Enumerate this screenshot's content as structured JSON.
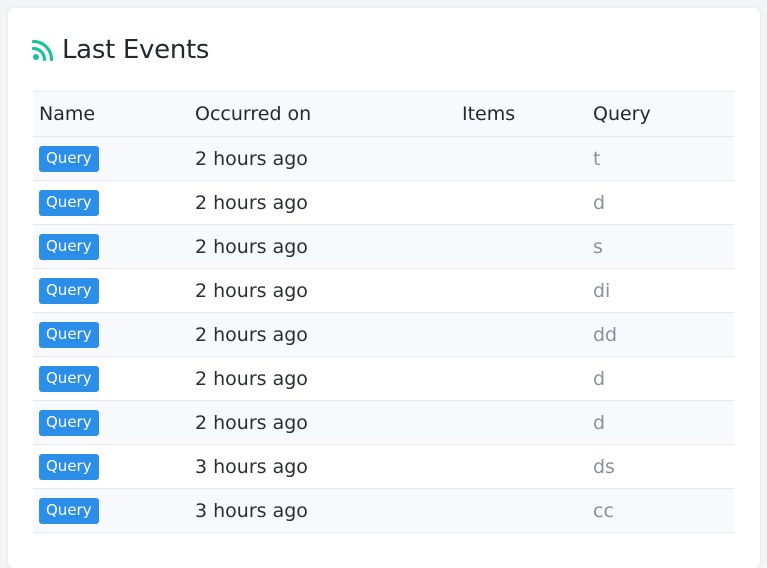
{
  "card": {
    "title": "Last Events",
    "icon": "rss-icon",
    "icon_color": "#19c3a0"
  },
  "table": {
    "headers": {
      "name": "Name",
      "occurred_on": "Occurred on",
      "items": "Items",
      "query": "Query"
    },
    "badge_color": "#2b8ee8",
    "rows": [
      {
        "name": "Query",
        "occurred_on": "2 hours ago",
        "items": "",
        "query": "t"
      },
      {
        "name": "Query",
        "occurred_on": "2 hours ago",
        "items": "",
        "query": "d"
      },
      {
        "name": "Query",
        "occurred_on": "2 hours ago",
        "items": "",
        "query": "s"
      },
      {
        "name": "Query",
        "occurred_on": "2 hours ago",
        "items": "",
        "query": "di"
      },
      {
        "name": "Query",
        "occurred_on": "2 hours ago",
        "items": "",
        "query": "dd"
      },
      {
        "name": "Query",
        "occurred_on": "2 hours ago",
        "items": "",
        "query": "d"
      },
      {
        "name": "Query",
        "occurred_on": "2 hours ago",
        "items": "",
        "query": "d"
      },
      {
        "name": "Query",
        "occurred_on": "3 hours ago",
        "items": "",
        "query": "ds"
      },
      {
        "name": "Query",
        "occurred_on": "3 hours ago",
        "items": "",
        "query": "cc"
      }
    ]
  }
}
